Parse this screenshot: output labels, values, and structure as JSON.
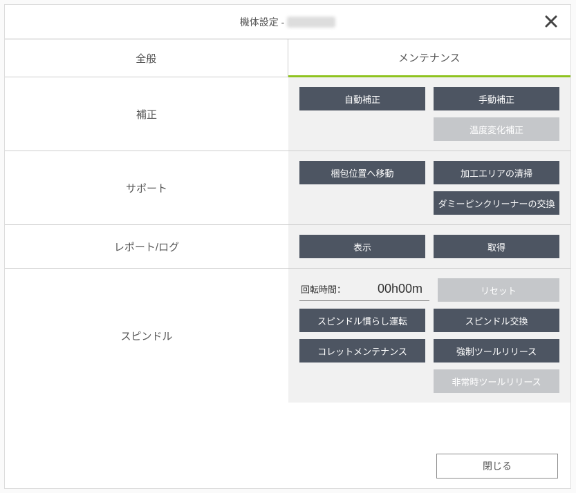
{
  "title_prefix": "機体設定 - ",
  "tabs": {
    "general": "全般",
    "maintenance": "メンテナンス"
  },
  "sections": {
    "correction": {
      "label": "補正",
      "btn_auto": "自動補正",
      "btn_manual": "手動補正",
      "btn_temp": "温度変化補正"
    },
    "support": {
      "label": "サポート",
      "btn_pack": "梱包位置へ移動",
      "btn_clean": "加工エリアの清掃",
      "btn_dummy": "ダミーピンクリーナーの交換"
    },
    "report": {
      "label": "レポート/ログ",
      "btn_show": "表示",
      "btn_get": "取得"
    },
    "spindle": {
      "label": "スピンドル",
      "time_label": "回転時間：",
      "time_value": "00h00m",
      "btn_reset": "リセット",
      "btn_break_in": "スピンドル慣らし運転",
      "btn_replace": "スピンドル交換",
      "btn_collet": "コレットメンテナンス",
      "btn_force_release": "強制ツールリリース",
      "btn_emergency_release": "非常時ツールリリース"
    }
  },
  "footer": {
    "close": "閉じる"
  }
}
